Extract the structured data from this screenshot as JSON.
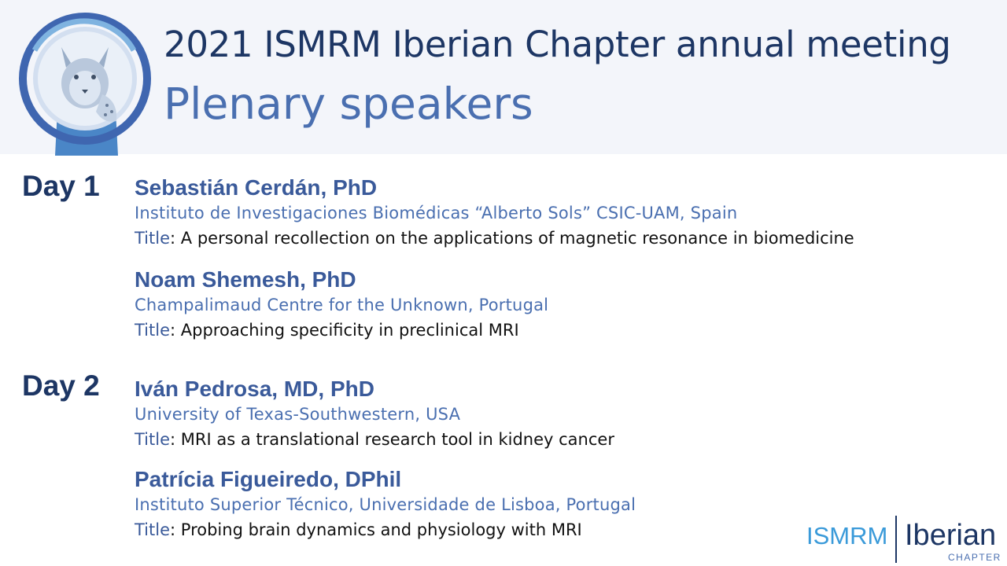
{
  "header": {
    "title": "2021 ISMRM Iberian Chapter annual meeting",
    "subtitle": "Plenary speakers"
  },
  "days": [
    {
      "label": "Day 1",
      "speakers": [
        {
          "name": "Sebastián Cerdán, PhD",
          "affiliation": "Instituto de Investigaciones Biomédicas “Alberto Sols” CSIC-UAM, Spain",
          "title_label": "Title",
          "title": "A personal recollection on the applications of magnetic resonance in biomedicine"
        },
        {
          "name": "Noam Shemesh, PhD",
          "affiliation": "Champalimaud Centre for the Unknown, Portugal",
          "title_label": "Title",
          "title": "Approaching specificity in preclinical MRI"
        }
      ]
    },
    {
      "label": "Day 2",
      "speakers": [
        {
          "name": "Iván Pedrosa, MD, PhD",
          "affiliation": "University of Texas-Southwestern, USA",
          "title_label": "Title",
          "title": "MRI as a translational research tool in kidney cancer"
        },
        {
          "name": "Patrícia Figueiredo, DPhil",
          "affiliation": "Instituto Superior Técnico, Universidade de Lisboa, Portugal",
          "title_label": "Title",
          "title": "Probing brain dynamics and physiology with MRI"
        }
      ]
    }
  ],
  "footer_logo": {
    "left": "ISMRM",
    "right": "Iberian",
    "sub": "CHAPTER"
  },
  "colors": {
    "navy": "#1d3664",
    "blue": "#4a6fb0",
    "accent": "#3a9ad9",
    "header_bg": "#f3f5fa"
  },
  "icons": {
    "header_logo": "lynx-badge-logo"
  }
}
